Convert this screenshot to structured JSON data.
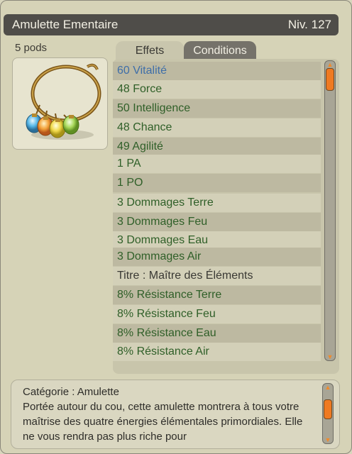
{
  "item": {
    "name": "Amulette Ementaire",
    "level": "Niv. 127",
    "weight": "5 pods"
  },
  "tabs": {
    "effects": "Effets",
    "conditions": "Conditions"
  },
  "effects": [
    {
      "text": "60 Vitalité",
      "style": "blue"
    },
    {
      "text": "48 Force",
      "style": "green"
    },
    {
      "text": "50 Intelligence",
      "style": "green"
    },
    {
      "text": "48 Chance",
      "style": "green"
    },
    {
      "text": "49 Agilité",
      "style": "green"
    },
    {
      "text": "1 PA",
      "style": "green"
    },
    {
      "text": "1 PO",
      "style": "green"
    },
    {
      "text": "3 Dommages Terre",
      "style": "green"
    },
    {
      "text": "3 Dommages Feu",
      "style": "green"
    },
    {
      "text": "3 Dommages Eau",
      "style": "green"
    },
    {
      "text": "3 Dommages Air",
      "style": "green"
    },
    {
      "text": "Titre : Maître des Éléments",
      "style": "black"
    },
    {
      "text": "8% Résistance Terre",
      "style": "green"
    },
    {
      "text": "8% Résistance Feu",
      "style": "green"
    },
    {
      "text": "8% Résistance Eau",
      "style": "green"
    },
    {
      "text": "8% Résistance Air",
      "style": "green"
    }
  ],
  "description": {
    "category": "Catégorie : Amulette",
    "text": "Portée autour du cou, cette amulette montrera à tous votre maîtrise des quatre énergies élémentales primordiales. Elle ne vous rendra pas plus riche pour"
  },
  "colors": {
    "accent_orange": "#ef7a22",
    "bonus_green": "#2f5f28",
    "vitality_blue": "#3e6ea8",
    "title_bar": "#4f4d49"
  }
}
